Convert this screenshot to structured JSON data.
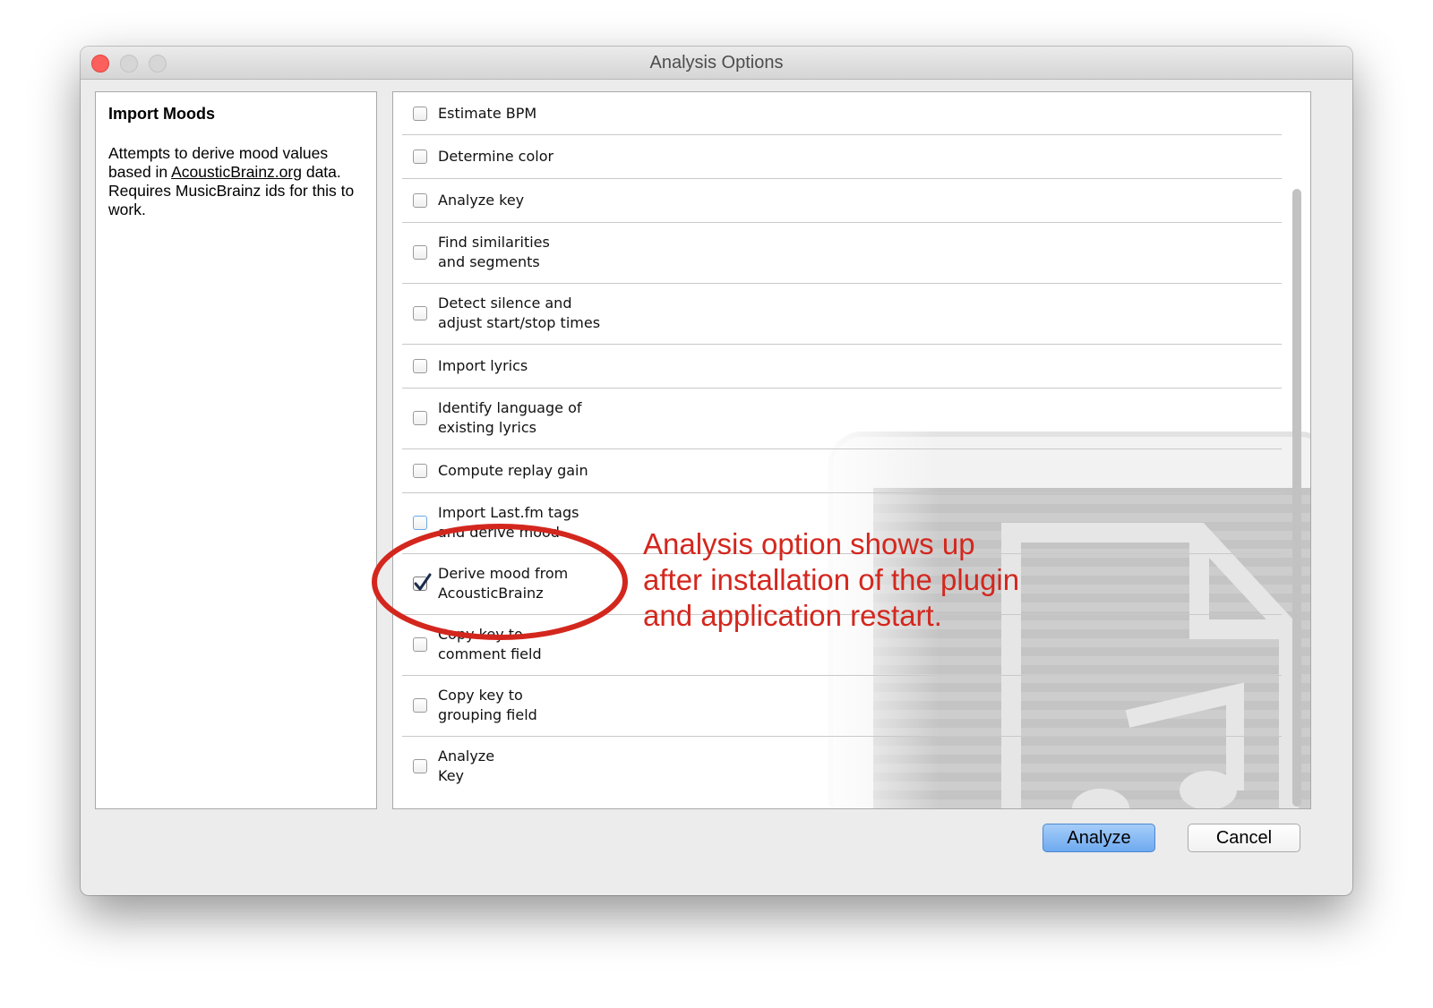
{
  "window": {
    "title": "Analysis Options"
  },
  "description": {
    "title": "Import Moods",
    "body_pre": "Attempts to derive mood values based in ",
    "link": "AcousticBrainz.org",
    "body_post": " data. Requires MusicBrainz ids for this to work."
  },
  "options": [
    {
      "label": "Estimate BPM",
      "checked": false
    },
    {
      "label": "Determine color",
      "checked": false
    },
    {
      "label": "Analyze key",
      "checked": false
    },
    {
      "label": "Find similarities\nand segments",
      "checked": false
    },
    {
      "label": "Detect silence and\nadjust start/stop times",
      "checked": false
    },
    {
      "label": "Import lyrics",
      "checked": false
    },
    {
      "label": "Identify language of\nexisting lyrics",
      "checked": false
    },
    {
      "label": "Compute replay gain",
      "checked": false
    },
    {
      "label": "Import Last.fm tags\nand derive mood",
      "checked": false
    },
    {
      "label": "Derive mood from\nAcousticBrainz",
      "checked": true
    },
    {
      "label": "Copy key to\ncomment field",
      "checked": false
    },
    {
      "label": "Copy key to\ngrouping field",
      "checked": false
    },
    {
      "label": "Analyze\nKey",
      "checked": false
    }
  ],
  "buttons": {
    "analyze": "Analyze",
    "cancel": "Cancel"
  },
  "annotation": {
    "text": "Analysis option shows up\nafter installation of the plugin\nand application restart."
  },
  "colors": {
    "annotation": "#d3271e",
    "accent": "#6eaaf0"
  }
}
